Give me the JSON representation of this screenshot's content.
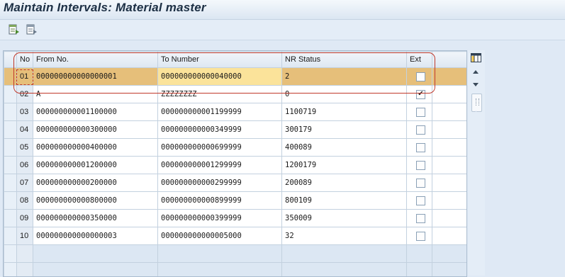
{
  "title": "Maintain Intervals: Material master",
  "toolbar": {
    "icons": [
      "table-insert-icon",
      "table-delete-icon"
    ]
  },
  "table": {
    "headers": {
      "no": "No",
      "from": "From No.",
      "to": "To Number",
      "status": "NR Status",
      "ext": "Ext"
    },
    "rows": [
      {
        "no": "01",
        "from": "000000000000000001",
        "to": "000000000000040000",
        "status": "2",
        "ext": false
      },
      {
        "no": "02",
        "from": "A",
        "to": "ZZZZZZZZ",
        "status": "0",
        "ext": true
      },
      {
        "no": "03",
        "from": "000000000001100000",
        "to": "000000000001199999",
        "status": "1100719",
        "ext": false
      },
      {
        "no": "04",
        "from": "000000000000300000",
        "to": "000000000000349999",
        "status": "300179",
        "ext": false
      },
      {
        "no": "05",
        "from": "000000000000400000",
        "to": "000000000000699999",
        "status": "400089",
        "ext": false
      },
      {
        "no": "06",
        "from": "000000000001200000",
        "to": "000000000001299999",
        "status": "1200179",
        "ext": false
      },
      {
        "no": "07",
        "from": "000000000000200000",
        "to": "000000000000299999",
        "status": "200089",
        "ext": false
      },
      {
        "no": "08",
        "from": "000000000000800000",
        "to": "000000000000899999",
        "status": "800109",
        "ext": false
      },
      {
        "no": "09",
        "from": "000000000000350000",
        "to": "000000000000399999",
        "status": "350009",
        "ext": false
      },
      {
        "no": "10",
        "from": "000000000000000003",
        "to": "000000000000005000",
        "status": "32",
        "ext": false
      }
    ]
  },
  "colors": {
    "highlight_row": "#e6bf7a",
    "annotation": "#c0392b"
  }
}
